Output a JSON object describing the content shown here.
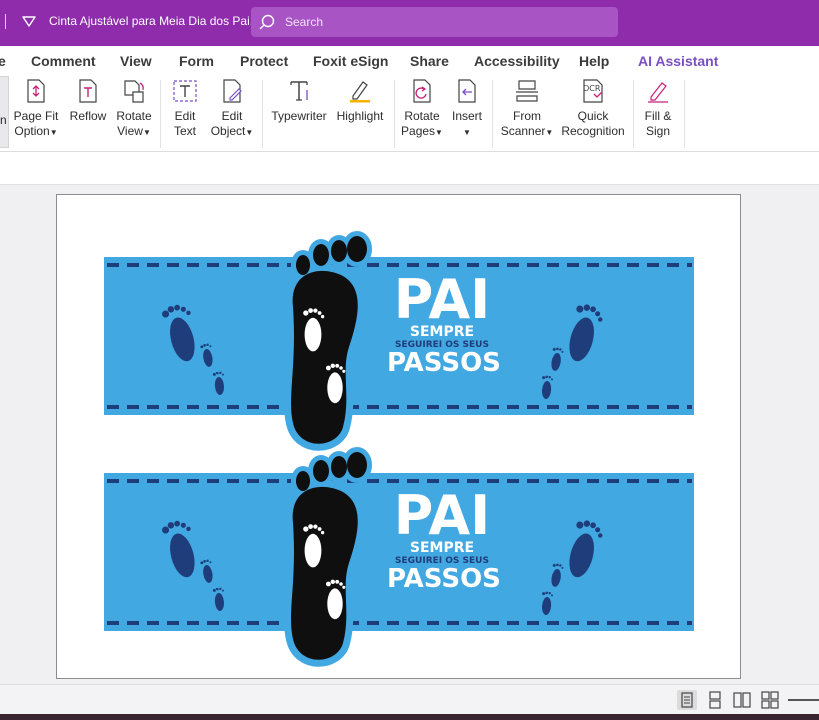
{
  "titlebar": {
    "document_title": "Cinta Ajustável para Meia Dia dos Pai...",
    "search_placeholder": "Search"
  },
  "menu": {
    "tabs": [
      {
        "label": "e"
      },
      {
        "label": "Comment"
      },
      {
        "label": "View"
      },
      {
        "label": "Form"
      },
      {
        "label": "Protect"
      },
      {
        "label": "Foxit eSign"
      },
      {
        "label": "Share"
      },
      {
        "label": "Accessibility"
      },
      {
        "label": "Help"
      },
      {
        "label": "AI Assistant"
      }
    ]
  },
  "ribbon": {
    "partial_left_label": "n",
    "buttons": [
      {
        "line1": "Page Fit",
        "line2": "Option",
        "icon": "page-fit-icon"
      },
      {
        "line1": "Reflow",
        "line2": "",
        "icon": "reflow-icon"
      },
      {
        "line1": "Rotate",
        "line2": "View",
        "icon": "rotate-view-icon"
      },
      {
        "line1": "Edit",
        "line2": "Text",
        "icon": "edit-text-icon"
      },
      {
        "line1": "Edit",
        "line2": "Object",
        "icon": "edit-object-icon"
      },
      {
        "line1": "Typewriter",
        "line2": "",
        "icon": "typewriter-icon"
      },
      {
        "line1": "Highlight",
        "line2": "",
        "icon": "highlight-icon"
      },
      {
        "line1": "Rotate",
        "line2": "Pages",
        "icon": "rotate-pages-icon"
      },
      {
        "line1": "Insert",
        "line2": "",
        "icon": "insert-icon"
      },
      {
        "line1": "From",
        "line2": "Scanner",
        "icon": "scanner-icon"
      },
      {
        "line1": "Quick",
        "line2": "Recognition",
        "icon": "ocr-icon"
      },
      {
        "line1": "Fill &",
        "line2": "Sign",
        "icon": "fill-sign-icon"
      }
    ],
    "ocr_badge": "OCR"
  },
  "document": {
    "banners": [
      {
        "title": "PAI",
        "line1": "SEMPRE",
        "line2": "SEGUIREI OS SEUS",
        "line3": "PASSOS"
      },
      {
        "title": "PAI",
        "line1": "SEMPRE",
        "line2": "SEGUIREI OS SEUS",
        "line3": "PASSOS"
      }
    ],
    "colors": {
      "band": "#42a8e2",
      "navy": "#1f3d7a",
      "foot": "#0f0f0f"
    }
  },
  "statusbar": {
    "view_modes": [
      "single-page-icon",
      "continuous-icon",
      "facing-icon",
      "continuous-facing-icon"
    ]
  }
}
